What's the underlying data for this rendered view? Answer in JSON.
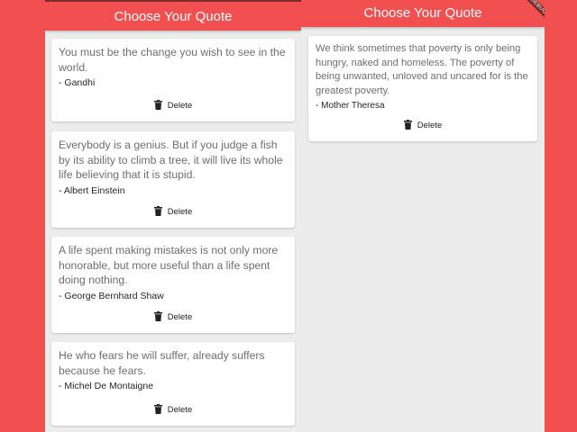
{
  "app": {
    "title": "Choose Your Quote",
    "debug_banner": "DEBUG"
  },
  "delete_label": "Delete",
  "icons": {
    "delete": "trash-icon"
  },
  "colors": {
    "appbar": "#f25050",
    "background": "#ececec",
    "card": "#ffffff"
  },
  "screens": [
    {
      "quotes": [
        {
          "text": "You must be the change you wish to see in the world.",
          "author": "- Gandhi"
        },
        {
          "text": "Everybody is a genius. But if you judge a fish by its ability to climb a tree, it will live its whole life believing that it is stupid.",
          "author": "- Albert Einstein"
        },
        {
          "text": "A life spent making mistakes is not only more honorable, but more useful than a life spent doing nothing.",
          "author": "- George Bernhard Shaw"
        },
        {
          "text": "He who fears he will suffer, already suffers because he fears.",
          "author": "- Michel De Montaigne"
        }
      ]
    },
    {
      "quotes": [
        {
          "text": "We think sometimes that poverty is only being hungry, naked and homeless. The poverty of being unwanted, unloved and uncared for is the greatest poverty.",
          "author": "- Mother Theresa"
        }
      ]
    }
  ]
}
